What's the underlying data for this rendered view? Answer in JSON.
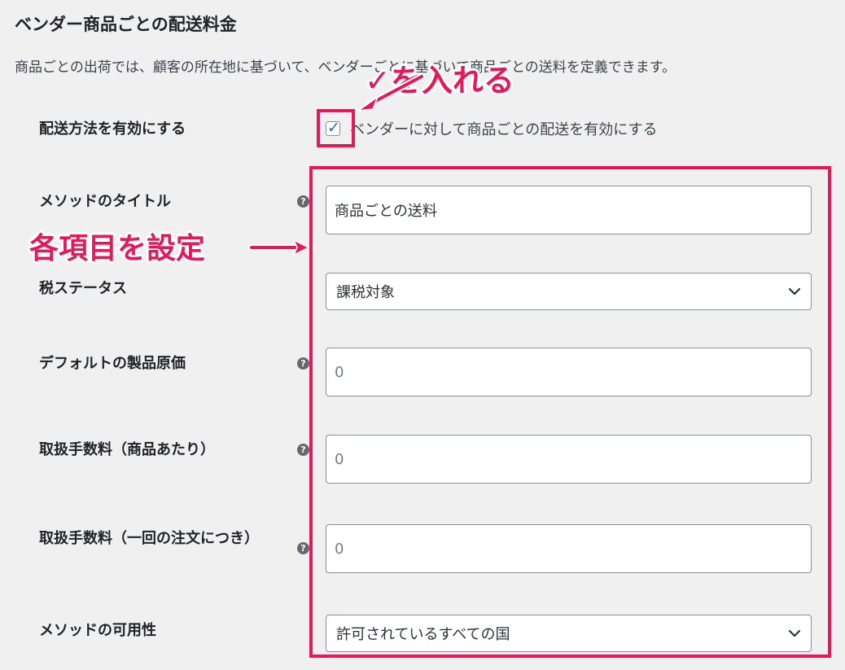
{
  "section": {
    "title": "ベンダー商品ごとの配送料金",
    "description": "商品ごとの出荷では、顧客の所在地に基づいて、ベンダーごとに基づいて商品ごとの送料を定義できます。"
  },
  "fields": {
    "enable_shipping": {
      "label": "配送方法を有効にする",
      "checked": true,
      "checkbox_label": "ベンダーに対して商品ごとの配送を有効にする"
    },
    "method_title": {
      "label": "メソッドのタイトル",
      "value": "商品ごとの送料",
      "help_icon": "question-mark-icon"
    },
    "tax_status": {
      "label": "税ステータス",
      "selected": "課税対象"
    },
    "default_cost": {
      "label": "デフォルトの製品原価",
      "placeholder": "0",
      "help_icon": "question-mark-icon"
    },
    "handling_fee_item": {
      "label": "取扱手数料（商品あたり）",
      "placeholder": "0",
      "help_icon": "question-mark-icon"
    },
    "handling_fee_order": {
      "label": "取扱手数料（一回の注文につき）",
      "placeholder": "0",
      "help_icon": "question-mark-icon"
    },
    "availability": {
      "label": "メソッドの可用性",
      "selected": "許可されているすべての国"
    }
  },
  "annotations": {
    "check_instruction": "✓を入れる",
    "settings_instruction": "各項目を設定",
    "color": "#e5195a"
  },
  "colors": {
    "accent": "#2271b1",
    "background": "#f0f0f1",
    "annotation": "#e5195a"
  }
}
